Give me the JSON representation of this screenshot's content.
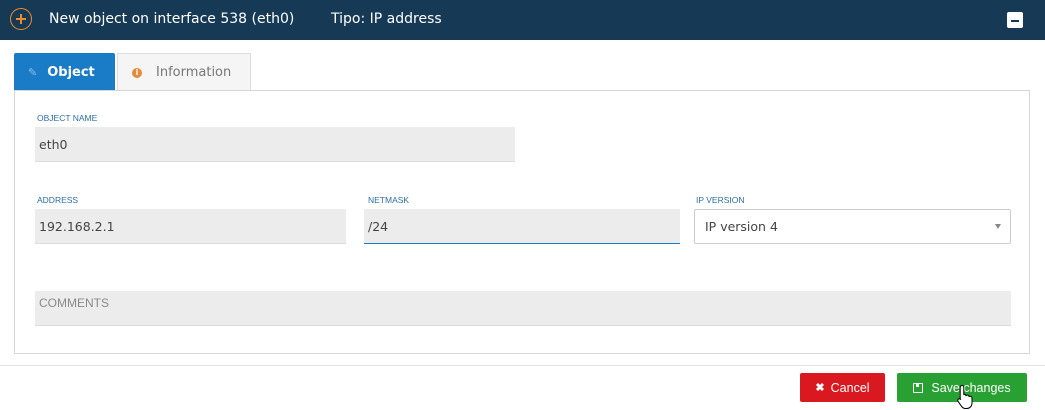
{
  "header": {
    "title": "New object on interface 538 (eth0)",
    "type_label": "Tipo: IP address",
    "add_icon": "add-circle-icon",
    "collapse_icon": "minus-square-icon"
  },
  "tabs": [
    {
      "label": "Object",
      "icon": "edit-icon",
      "active": true
    },
    {
      "label": "Information",
      "icon": "info-icon",
      "active": false
    }
  ],
  "form": {
    "object_name": {
      "label": "OBJECT NAME",
      "value": "eth0"
    },
    "address": {
      "label": "ADDRESS",
      "value": "192.168.2.1"
    },
    "netmask": {
      "label": "NETMASK",
      "value": "/24"
    },
    "ip_version": {
      "label": "IP VERSION",
      "value": "IP version 4"
    },
    "comments": {
      "placeholder": "COMMENTS",
      "value": ""
    }
  },
  "buttons": {
    "cancel_label": "Cancel",
    "save_label": "Save changes"
  },
  "colors": {
    "header_bg": "#163a55",
    "accent": "#1a7bc7",
    "add_icon": "#f08c2d",
    "cancel": "#d9191f",
    "save": "#29a132"
  }
}
